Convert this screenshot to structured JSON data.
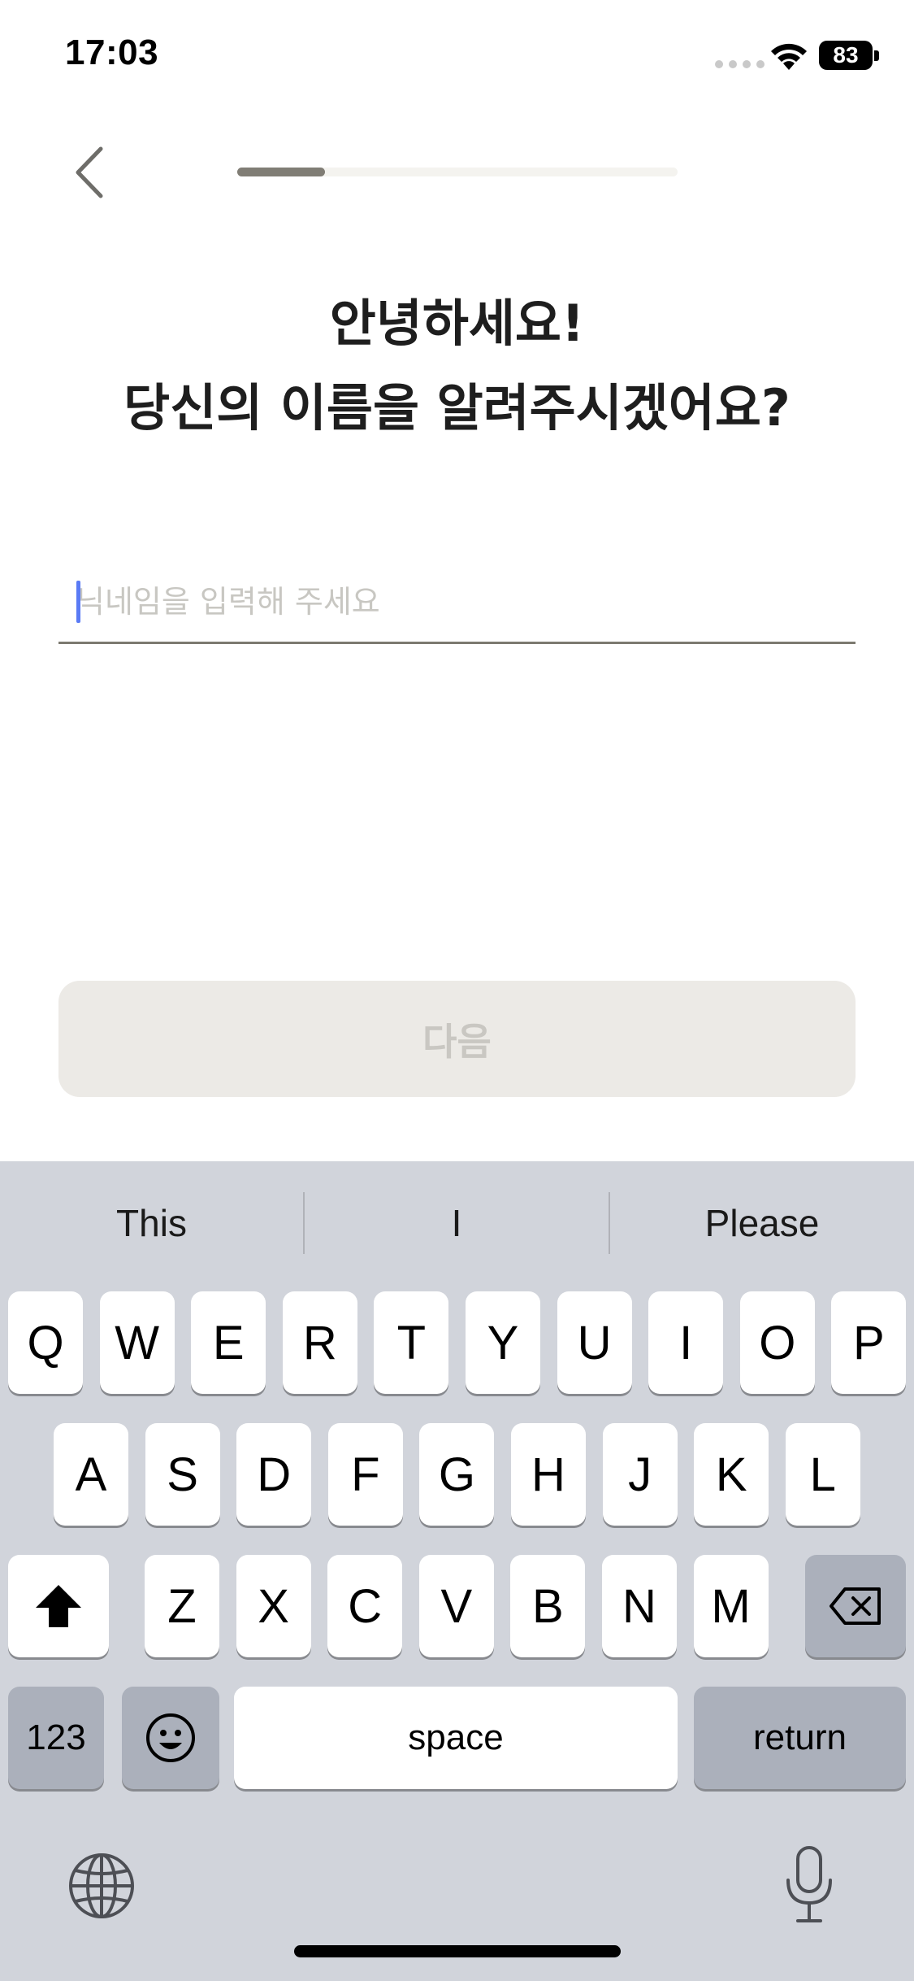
{
  "status_bar": {
    "time": "17:03",
    "battery": "83",
    "icons": [
      "cellular-signal-icon",
      "wifi-icon",
      "battery-icon"
    ]
  },
  "nav": {
    "back_icon": "chevron-left-icon",
    "progress": 0.2
  },
  "title": {
    "line1": "안녕하세요!",
    "line2": "당신의 이름을 알려주시겠어요?"
  },
  "name_field": {
    "placeholder": "닉네임을 입력해 주세요",
    "value": ""
  },
  "next_button": {
    "label": "다음",
    "enabled": false
  },
  "keyboard": {
    "suggestions": [
      "This",
      "I",
      "Please"
    ],
    "row1": [
      "Q",
      "W",
      "E",
      "R",
      "T",
      "Y",
      "U",
      "I",
      "O",
      "P"
    ],
    "row2": [
      "A",
      "S",
      "D",
      "F",
      "G",
      "H",
      "J",
      "K",
      "L"
    ],
    "row3": [
      "Z",
      "X",
      "C",
      "V",
      "B",
      "N",
      "M"
    ],
    "numbers_label": "123",
    "space_label": "space",
    "return_label": "return",
    "shift_icon": "shift-icon",
    "delete_icon": "delete-icon",
    "emoji_icon": "emoji-icon",
    "globe_icon": "globe-icon",
    "mic_icon": "microphone-icon"
  },
  "colors": {
    "progress_fill": "#807d75",
    "progress_track": "#f4f3ef",
    "button_disabled_bg": "#eceae6",
    "button_disabled_text": "#c9c7c2",
    "keyboard_bg": "#d1d4db",
    "caret": "#5a7bf5"
  }
}
